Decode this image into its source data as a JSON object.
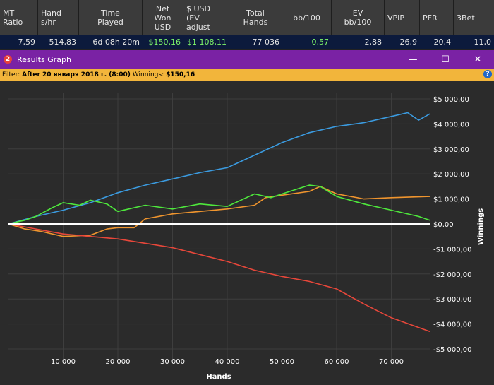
{
  "stats_table": {
    "headers": [
      "MT\nRatio",
      "Hand\ns/hr",
      "Time\nPlayed",
      "Net\nWon\nUSD",
      "$ USD\n(EV\nadjust",
      "Total\nHands",
      "bb/100",
      "EV\nbb/100",
      "VPIP",
      "PFR",
      "3Bet"
    ],
    "values": [
      "7,59",
      "514,83",
      "6d 08h 20m",
      "$150,16",
      "$1 108,11",
      "77 036",
      "0,57",
      "2,88",
      "26,9",
      "20,4",
      "11,0"
    ]
  },
  "window": {
    "icon_label": "2",
    "title": "Results Graph",
    "minimize_glyph": "—",
    "maximize_glyph": "☐",
    "close_glyph": "✕"
  },
  "filter": {
    "label": "Filter:",
    "value": "After 20 января 2018 г. (8:00)",
    "winnings_label": "Winnings:",
    "winnings_value": "$150,16",
    "help_glyph": "?"
  },
  "chart_data": {
    "type": "line",
    "xlabel": "Hands",
    "ylabel": "Winnings",
    "xlim": [
      0,
      77036
    ],
    "ylim": [
      -5000,
      5000
    ],
    "x_ticks": [
      10000,
      20000,
      30000,
      40000,
      50000,
      60000,
      70000
    ],
    "x_tick_labels": [
      "10 000",
      "20 000",
      "30 000",
      "40 000",
      "50 000",
      "60 000",
      "70 000"
    ],
    "y_ticks": [
      5000,
      4000,
      3000,
      2000,
      1000,
      0,
      -1000,
      -2000,
      -3000,
      -4000,
      -5000
    ],
    "y_tick_labels": [
      "$5 000,00",
      "$4 000,00",
      "$3 000,00",
      "$2 000,00",
      "$1 000,00",
      "$0,00",
      "-$1 000,00",
      "-$2 000,00",
      "-$3 000,00",
      "-$4 000,00",
      "-$5 000,00"
    ],
    "grid": true,
    "series": [
      {
        "color": "#3b9be0",
        "x": [
          0,
          5000,
          10000,
          15000,
          20000,
          25000,
          30000,
          35000,
          40000,
          45000,
          48000,
          50000,
          55000,
          60000,
          65000,
          70000,
          73000,
          75000,
          77036
        ],
        "y": [
          0,
          300,
          550,
          850,
          1250,
          1550,
          1800,
          2050,
          2250,
          2750,
          3050,
          3250,
          3650,
          3900,
          4050,
          4300,
          4450,
          4150,
          4400
        ]
      },
      {
        "color": "#f0952e",
        "x": [
          0,
          3000,
          6000,
          10000,
          15000,
          18000,
          20000,
          23000,
          25000,
          30000,
          35000,
          40000,
          45000,
          47000,
          50000,
          55000,
          57000,
          60000,
          65000,
          70000,
          77036
        ],
        "y": [
          0,
          -200,
          -300,
          -500,
          -450,
          -200,
          -150,
          -150,
          200,
          400,
          500,
          600,
          750,
          1050,
          1150,
          1300,
          1500,
          1200,
          1000,
          1050,
          1100
        ]
      },
      {
        "color": "#4ee83c",
        "x": [
          0,
          3000,
          5000,
          8000,
          10000,
          13000,
          15000,
          18000,
          20000,
          25000,
          30000,
          35000,
          40000,
          45000,
          48000,
          50000,
          55000,
          57000,
          60000,
          65000,
          70000,
          75000,
          77036
        ],
        "y": [
          0,
          150,
          300,
          650,
          850,
          750,
          950,
          800,
          500,
          750,
          600,
          800,
          700,
          1200,
          1050,
          1200,
          1550,
          1500,
          1100,
          800,
          550,
          300,
          150
        ]
      },
      {
        "color": "#e8473a",
        "x": [
          0,
          10000,
          20000,
          30000,
          40000,
          45000,
          50000,
          55000,
          60000,
          65000,
          70000,
          77036
        ],
        "y": [
          0,
          -400,
          -600,
          -950,
          -1500,
          -1850,
          -2100,
          -2300,
          -2600,
          -3200,
          -3750,
          -4300
        ]
      },
      {
        "color": "#ffffff",
        "x": [
          0,
          77036
        ],
        "y": [
          0,
          0
        ]
      }
    ]
  }
}
